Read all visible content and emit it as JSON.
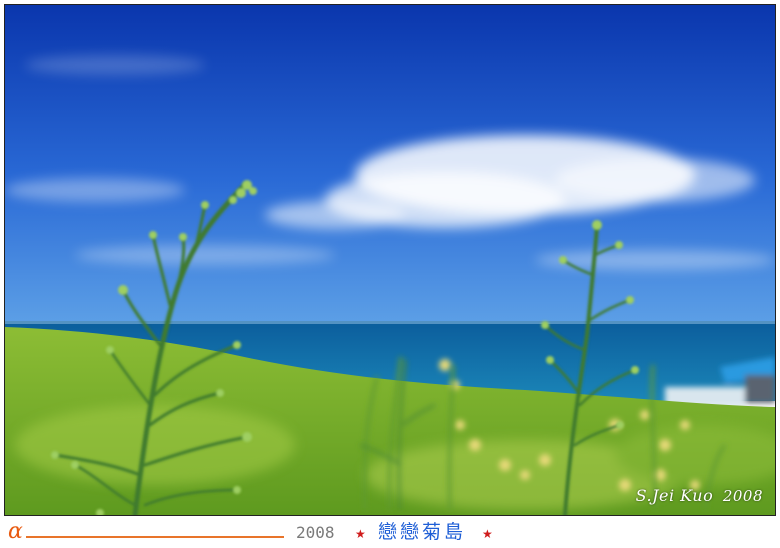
{
  "photo": {
    "colors": {
      "sky_top": "#0d3fb8",
      "sky_horizon": "#4a8fe0",
      "sea": "#126aa8",
      "grass": "#7cae2a",
      "stem": "#3f7a2e"
    }
  },
  "signature": {
    "name": "S.Jei Kuo",
    "year": "2008"
  },
  "caption": {
    "alpha": "α",
    "year": "2008",
    "star": "★",
    "title": "戀戀菊島",
    "accent": "#e8742a",
    "title_color": "#1f5fd6"
  }
}
